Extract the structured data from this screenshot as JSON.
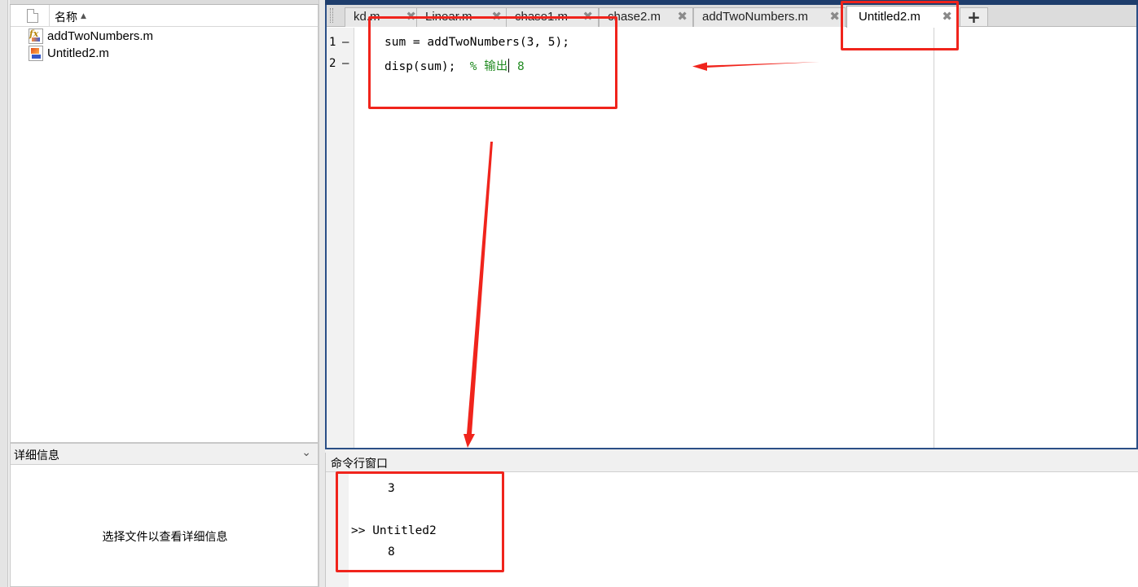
{
  "file_browser": {
    "column_name": "名称",
    "files": [
      {
        "name": "addTwoNumbers.m",
        "icon": "function-file-icon"
      },
      {
        "name": "Untitled2.m",
        "icon": "script-file-icon"
      }
    ]
  },
  "details": {
    "title": "详细信息",
    "placeholder": "选择文件以查看详细信息"
  },
  "editor": {
    "tabs": [
      {
        "label": "kd.m",
        "active": false
      },
      {
        "label": "Linear.m",
        "active": false
      },
      {
        "label": "chase1.m",
        "active": false
      },
      {
        "label": "chase2.m",
        "active": false
      },
      {
        "label": "addTwoNumbers.m",
        "active": false
      },
      {
        "label": "Untitled2.m",
        "active": true
      }
    ],
    "add_tab": "+",
    "close_glyph": "✖",
    "lines": [
      {
        "number": "1",
        "marker": "—",
        "code": "sum = addTwoNumbers(3, 5);",
        "comment": ""
      },
      {
        "number": "2",
        "marker": "—",
        "code": "disp(sum);  ",
        "comment_prefix": "% 输出",
        "comment": " 8"
      }
    ]
  },
  "command_window": {
    "title": "命令行窗口",
    "output_prev": "3",
    "prompt": ">> Untitled2",
    "output": "8"
  },
  "annotations": {
    "color": "#f0241c"
  }
}
